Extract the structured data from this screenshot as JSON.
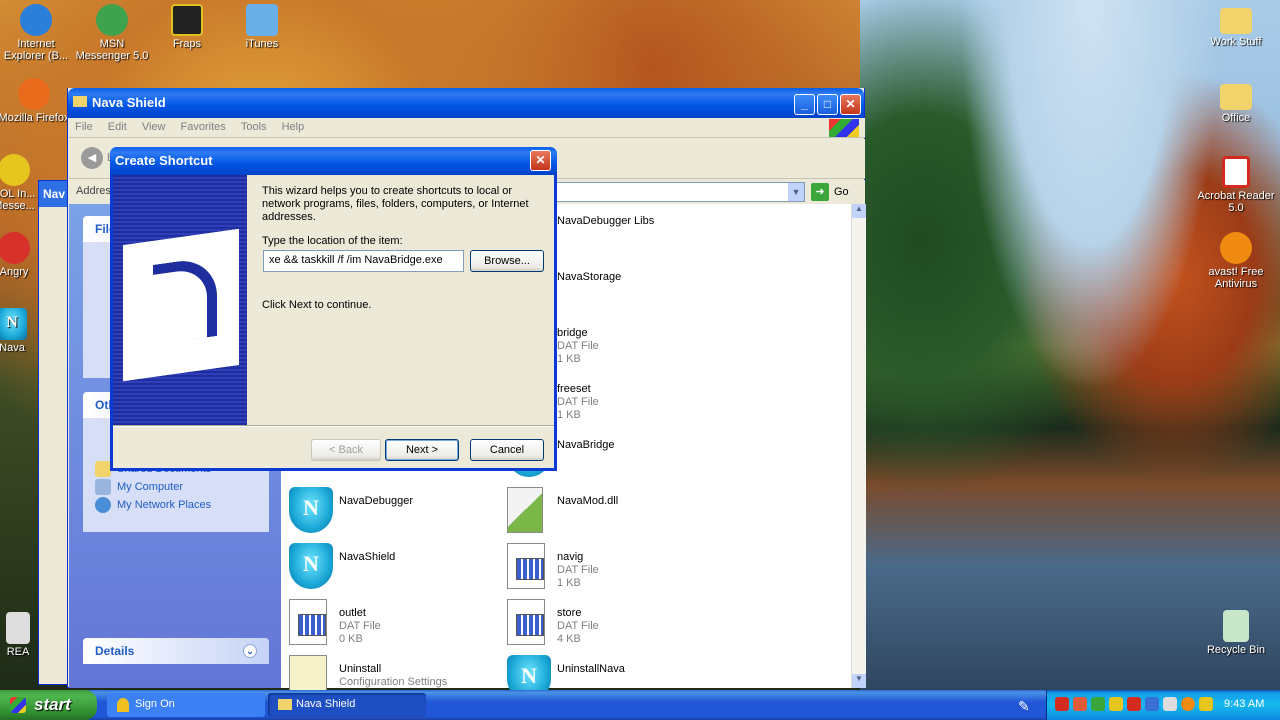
{
  "desktop": {
    "left_icons": [
      {
        "label": "Internet Explorer (B...",
        "icon": "internet-explorer-icon",
        "color": "#2a7fd8"
      },
      {
        "label": "MSN Messenger 5.0",
        "icon": "msn-messenger-icon",
        "color": "#3fa34d"
      },
      {
        "label": "Fraps",
        "icon": "fraps-icon",
        "color": "#e0c020"
      },
      {
        "label": "iTunes",
        "icon": "itunes-icon",
        "color": "#6aaee8"
      },
      {
        "label": "Mozilla Firefox",
        "icon": "firefox-icon",
        "color": "#e86a1a"
      },
      {
        "label": "AOL In... Messe...",
        "icon": "aol-messenger-icon",
        "color": "#e6c61e"
      },
      {
        "label": "Angry",
        "icon": "angry-birds-icon",
        "color": "#d8302a"
      },
      {
        "label": "Nava",
        "icon": "nava-icon",
        "color": "#1aa7d6"
      },
      {
        "label": "REA",
        "icon": "readme-icon",
        "color": "#dddddd"
      }
    ],
    "right_icons": [
      {
        "label": "Work Stuff",
        "icon": "folder-icon",
        "color": "#f1d36b"
      },
      {
        "label": "Office",
        "icon": "office-folder-icon",
        "color": "#f1d36b"
      },
      {
        "label": "Acrobat Reader 5.0",
        "icon": "acrobat-icon",
        "color": "#d42a20"
      },
      {
        "label": "avast! Free Antivirus",
        "icon": "avast-icon",
        "color": "#f08a10"
      },
      {
        "label": "Recycle Bin",
        "icon": "recycle-bin-icon",
        "color": "#c8e6c8"
      }
    ]
  },
  "explorer": {
    "title": "Nava Shield",
    "menu": [
      "File",
      "Edit",
      "View",
      "Favorites",
      "Tools",
      "Help"
    ],
    "address_label": "Address",
    "go_label": "Go",
    "back_label": "B",
    "left_pane": {
      "file_tasks_header": "File",
      "other_places_header": "Oth",
      "other_places": [
        {
          "label": "Shared Documents",
          "icon": "folder-icon"
        },
        {
          "label": "My Computer",
          "icon": "my-computer-icon"
        },
        {
          "label": "My Network Places",
          "icon": "network-places-icon"
        }
      ],
      "details_header": "Details"
    },
    "files": [
      {
        "name": "NavaDebugger Libs",
        "type": "",
        "size": "",
        "icon": "folder"
      },
      {
        "name": "NavaStorage",
        "type": "",
        "size": "",
        "icon": "folder"
      },
      {
        "name": "bridge",
        "type": "DAT File",
        "size": "1 KB",
        "icon": "dat"
      },
      {
        "name": "freeset",
        "type": "DAT File",
        "size": "1 KB",
        "icon": "dat"
      },
      {
        "name": "NavaBridge",
        "type": "",
        "size": "",
        "icon": "shield"
      },
      {
        "name": "NavaDebugger",
        "type": "",
        "size": "",
        "icon": "shield"
      },
      {
        "name": "NavaMod.dll",
        "type": "",
        "size": "",
        "icon": "dll"
      },
      {
        "name": "NavaShield",
        "type": "",
        "size": "",
        "icon": "shield"
      },
      {
        "name": "navig",
        "type": "DAT File",
        "size": "1 KB",
        "icon": "dat"
      },
      {
        "name": "outlet",
        "type": "DAT File",
        "size": "0 KB",
        "icon": "dat"
      },
      {
        "name": "store",
        "type": "DAT File",
        "size": "4 KB",
        "icon": "dat"
      },
      {
        "name": "Uninstall",
        "type": "Configuration Settings",
        "size": "",
        "icon": "config"
      },
      {
        "name": "UninstallNava",
        "type": "",
        "size": "",
        "icon": "shield"
      }
    ]
  },
  "dialog": {
    "title": "Create Shortcut",
    "intro": "This wizard helps you to create shortcuts to local or network programs, files, folders, computers, or Internet addresses.",
    "location_label": "Type the location of the item:",
    "location_value": "xe && taskkill /f /im NavaBridge.exe",
    "browse_label": "Browse...",
    "continue_text": "Click Next to continue.",
    "back_label": "< Back",
    "next_label": "Next >",
    "cancel_label": "Cancel"
  },
  "taskbar": {
    "start_label": "start",
    "items": [
      {
        "label": "Sign On",
        "icon": "aim-icon"
      },
      {
        "label": "Nava Shield",
        "icon": "folder-icon"
      }
    ],
    "clock": "9:43 AM"
  }
}
